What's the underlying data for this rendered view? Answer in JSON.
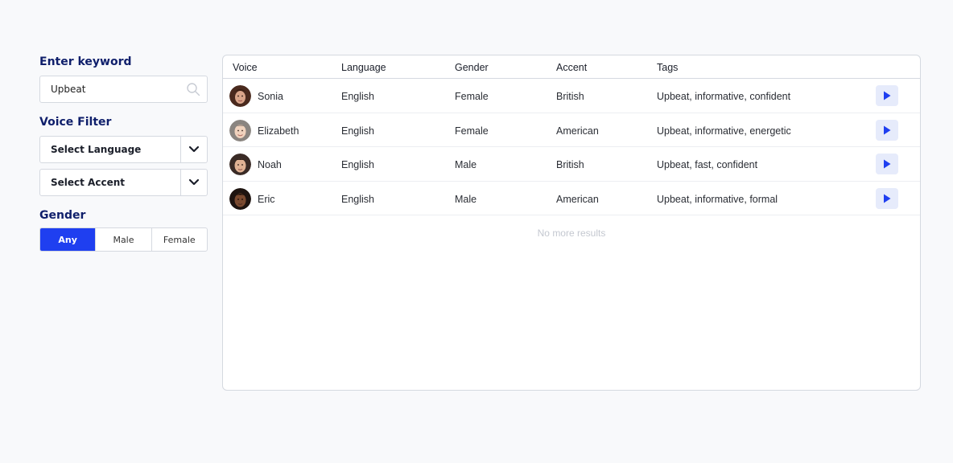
{
  "filters": {
    "keyword_title": "Enter keyword",
    "keyword_value": "Upbeat",
    "voice_filter_title": "Voice Filter",
    "language_select": "Select Language",
    "accent_select": "Select Accent",
    "gender_title": "Gender",
    "gender_options": [
      "Any",
      "Male",
      "Female"
    ],
    "gender_selected": "Any"
  },
  "table": {
    "headers": {
      "voice": "Voice",
      "language": "Language",
      "gender": "Gender",
      "accent": "Accent",
      "tags": "Tags"
    },
    "rows": [
      {
        "voice": "Sonia",
        "language": "English",
        "gender": "Female",
        "accent": "British",
        "tags": "Upbeat, informative, confident"
      },
      {
        "voice": "Elizabeth",
        "language": "English",
        "gender": "Female",
        "accent": "American",
        "tags": "Upbeat, informative, energetic"
      },
      {
        "voice": "Noah",
        "language": "English",
        "gender": "Male",
        "accent": "British",
        "tags": "Upbeat, fast, confident"
      },
      {
        "voice": "Eric",
        "language": "English",
        "gender": "Male",
        "accent": "American",
        "tags": "Upbeat, informative, formal"
      }
    ],
    "footer_note": "No more results"
  },
  "colors": {
    "accent": "#1f3ff0",
    "title": "#0f1f6b",
    "play_bg": "#e6ebfb"
  },
  "icons": {
    "search": "search-icon",
    "chevron": "chevron-down-icon",
    "play": "play-icon"
  }
}
